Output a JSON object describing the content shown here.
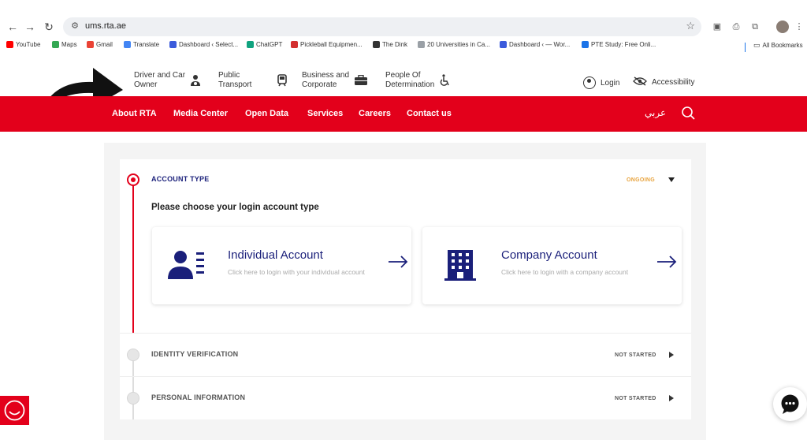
{
  "browser": {
    "url": "ums.rta.ae",
    "bookmarks": [
      {
        "label": "YouTube",
        "color": "#ff0000"
      },
      {
        "label": "Maps",
        "color": "#34a853"
      },
      {
        "label": "Gmail",
        "color": "#ea4335"
      },
      {
        "label": "Translate",
        "color": "#4285f4"
      },
      {
        "label": "Dashboard ‹ Select...",
        "color": "#3b5bdb"
      },
      {
        "label": "ChatGPT",
        "color": "#10a37f"
      },
      {
        "label": "Pickleball Equipmen...",
        "color": "#d32f2f"
      },
      {
        "label": "The Dink",
        "color": "#333333"
      },
      {
        "label": "20 Universities in Ca...",
        "color": "#9aa0a6"
      },
      {
        "label": "Dashboard ‹ — Wor...",
        "color": "#3b5bdb"
      },
      {
        "label": "PTE Study: Free Onli...",
        "color": "#1a73e8"
      }
    ],
    "all_bookmarks": "All Bookmarks"
  },
  "header": {
    "nav": [
      {
        "line1": "Driver and Car",
        "line2": "Owner"
      },
      {
        "line1": "Public",
        "line2": "Transport"
      },
      {
        "line1": "Business and",
        "line2": "Corporate"
      },
      {
        "line1": "People Of",
        "line2": "Determination"
      }
    ],
    "login": "Login",
    "accessibility": "Accessibility"
  },
  "menu": {
    "items": [
      "About RTA",
      "Media Center",
      "Open Data",
      "Services",
      "Careers",
      "Contact us"
    ],
    "language": "عربي"
  },
  "steps": [
    {
      "title": "ACCOUNT TYPE",
      "status": "ONGOING",
      "status_color": "#e8a33d"
    },
    {
      "title": "IDENTITY VERIFICATION",
      "status": "NOT STARTED",
      "status_color": "#555555"
    },
    {
      "title": "PERSONAL INFORMATION",
      "status": "NOT STARTED",
      "status_color": "#555555"
    }
  ],
  "prompt": "Please choose your login account type",
  "accounts": [
    {
      "title": "Individual Account",
      "subtitle": "Click here to login with your individual account"
    },
    {
      "title": "Company Account",
      "subtitle": "Click here to login with a company account"
    }
  ],
  "colors": {
    "brand_red": "#e3001b",
    "brand_navy": "#1a1f7a"
  }
}
